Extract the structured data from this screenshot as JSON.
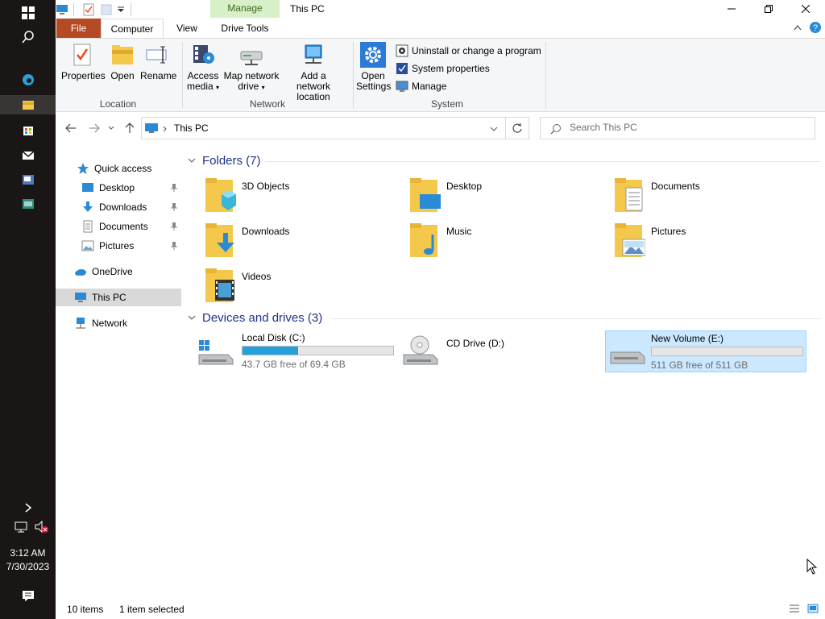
{
  "taskbar": {
    "clock_time": "3:12 AM",
    "clock_date": "7/30/2023"
  },
  "titlebar": {
    "title": "This PC",
    "context_tab": "Manage"
  },
  "tabs": {
    "file": "File",
    "computer": "Computer",
    "view": "View",
    "drive_tools": "Drive Tools"
  },
  "ribbon": {
    "location": {
      "label": "Location",
      "properties": "Properties",
      "open": "Open",
      "rename": "Rename"
    },
    "network": {
      "label": "Network",
      "access_media_1": "Access",
      "access_media_2": "media",
      "map_drive_1": "Map network",
      "map_drive_2": "drive",
      "add_location_1": "Add a network",
      "add_location_2": "location"
    },
    "system": {
      "label": "System",
      "open_settings_1": "Open",
      "open_settings_2": "Settings",
      "uninstall": "Uninstall or change a program",
      "system_properties": "System properties",
      "manage": "Manage"
    }
  },
  "address": {
    "path": "This PC",
    "search_placeholder": "Search This PC"
  },
  "navpane": {
    "quick_access": "Quick access",
    "desktop": "Desktop",
    "downloads": "Downloads",
    "documents": "Documents",
    "pictures": "Pictures",
    "onedrive": "OneDrive",
    "this_pc": "This PC",
    "network": "Network"
  },
  "content": {
    "folders_header": "Folders (7)",
    "folders": [
      "3D Objects",
      "Desktop",
      "Documents",
      "Downloads",
      "Music",
      "Pictures",
      "Videos"
    ],
    "drives_header": "Devices and drives (3)",
    "drives": [
      {
        "name": "Local Disk (C:)",
        "free": "43.7 GB free of 69.4 GB",
        "used_fraction": 0.37
      },
      {
        "name": "CD Drive (D:)"
      },
      {
        "name": "New Volume (E:)",
        "free": "511 GB free of 511 GB",
        "used_fraction": 0.0
      }
    ]
  },
  "status": {
    "items": "10 items",
    "selected": "1 item selected"
  },
  "colors": {
    "accent_file": "#b54b25",
    "manage_bg": "#d7f0c7",
    "selection": "#cce8ff",
    "progress": "#26a0da"
  }
}
